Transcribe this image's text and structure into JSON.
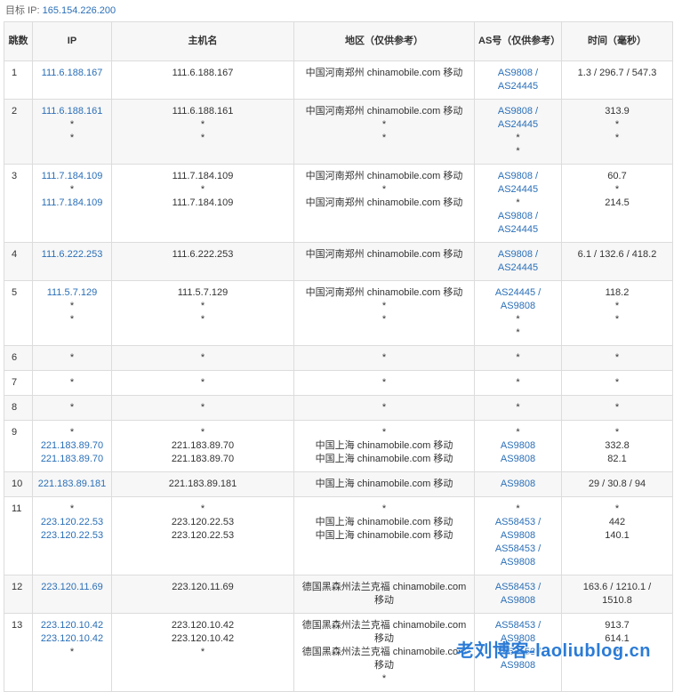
{
  "target": {
    "label": "目标 IP:",
    "ip": "165.154.226.200"
  },
  "headers": [
    "跳数",
    "IP",
    "主机名",
    "地区（仅供参考）",
    "AS号（仅供参考）",
    "时间（毫秒）"
  ],
  "rows": [
    {
      "hop": "1",
      "ip": [
        "111.6.188.167"
      ],
      "host": [
        "111.6.188.167"
      ],
      "region": [
        "中国河南郑州 chinamobile.com 移动"
      ],
      "as": [
        "AS9808 /",
        "AS24445"
      ],
      "time": [
        "1.3 / 296.7 / 547.3"
      ]
    },
    {
      "hop": "2",
      "ip": [
        "111.6.188.161",
        "*",
        "*"
      ],
      "host": [
        "111.6.188.161",
        "*",
        "*"
      ],
      "region": [
        "中国河南郑州 chinamobile.com 移动",
        "*",
        "*"
      ],
      "as": [
        "AS9808 /",
        "AS24445",
        "*",
        "*"
      ],
      "time": [
        "313.9",
        "*",
        "*"
      ]
    },
    {
      "hop": "3",
      "ip": [
        "111.7.184.109",
        "*",
        "111.7.184.109"
      ],
      "host": [
        "111.7.184.109",
        "*",
        "111.7.184.109"
      ],
      "region": [
        "中国河南郑州 chinamobile.com 移动",
        "*",
        "中国河南郑州 chinamobile.com 移动"
      ],
      "as": [
        "AS9808 /",
        "AS24445",
        "*",
        "AS9808 /",
        "AS24445"
      ],
      "time": [
        "60.7",
        "*",
        "214.5"
      ]
    },
    {
      "hop": "4",
      "ip": [
        "111.6.222.253"
      ],
      "host": [
        "111.6.222.253"
      ],
      "region": [
        "中国河南郑州 chinamobile.com 移动"
      ],
      "as": [
        "AS9808 /",
        "AS24445"
      ],
      "time": [
        "6.1 / 132.6 / 418.2"
      ]
    },
    {
      "hop": "5",
      "ip": [
        "111.5.7.129",
        "*",
        "*"
      ],
      "host": [
        "111.5.7.129",
        "*",
        "*"
      ],
      "region": [
        "中国河南郑州 chinamobile.com 移动",
        "*",
        "*"
      ],
      "as": [
        "AS24445 /",
        "AS9808",
        "*",
        "*"
      ],
      "time": [
        "118.2",
        "*",
        "*"
      ]
    },
    {
      "hop": "6",
      "ip": [
        "*"
      ],
      "host": [
        "*"
      ],
      "region": [
        "*"
      ],
      "as": [
        "*"
      ],
      "time": [
        "*"
      ]
    },
    {
      "hop": "7",
      "ip": [
        "*"
      ],
      "host": [
        "*"
      ],
      "region": [
        "*"
      ],
      "as": [
        "*"
      ],
      "time": [
        "*"
      ]
    },
    {
      "hop": "8",
      "ip": [
        "*"
      ],
      "host": [
        "*"
      ],
      "region": [
        "*"
      ],
      "as": [
        "*"
      ],
      "time": [
        "*"
      ]
    },
    {
      "hop": "9",
      "ip": [
        "*",
        "221.183.89.70",
        "221.183.89.70"
      ],
      "host": [
        "*",
        "221.183.89.70",
        "221.183.89.70"
      ],
      "region": [
        "*",
        "中国上海 chinamobile.com 移动",
        "中国上海 chinamobile.com 移动"
      ],
      "as": [
        "*",
        "AS9808",
        "AS9808"
      ],
      "time": [
        "*",
        "332.8",
        "82.1"
      ]
    },
    {
      "hop": "10",
      "ip": [
        "221.183.89.181"
      ],
      "host": [
        "221.183.89.181"
      ],
      "region": [
        "中国上海 chinamobile.com 移动"
      ],
      "as": [
        "AS9808"
      ],
      "time": [
        "29 / 30.8 / 94"
      ]
    },
    {
      "hop": "11",
      "ip": [
        "*",
        "223.120.22.53",
        "223.120.22.53"
      ],
      "host": [
        "*",
        "223.120.22.53",
        "223.120.22.53"
      ],
      "region": [
        "*",
        "中国上海 chinamobile.com 移动",
        "中国上海 chinamobile.com 移动"
      ],
      "as": [
        "*",
        "AS58453 /",
        "AS9808",
        "AS58453 /",
        "AS9808"
      ],
      "time": [
        "*",
        "442",
        "140.1"
      ]
    },
    {
      "hop": "12",
      "ip": [
        "223.120.11.69"
      ],
      "host": [
        "223.120.11.69"
      ],
      "region": [
        "德国黑森州法兰克福 chinamobile.com",
        "移动"
      ],
      "as": [
        "AS58453 /",
        "AS9808"
      ],
      "time": [
        "163.6 / 1210.1 /",
        "1510.8"
      ]
    },
    {
      "hop": "13",
      "ip": [
        "223.120.10.42",
        "223.120.10.42",
        "*"
      ],
      "host": [
        "223.120.10.42",
        "223.120.10.42",
        "*"
      ],
      "region": [
        "德国黑森州法兰克福 chinamobile.com",
        "移动",
        "德国黑森州法兰克福 chinamobile.com",
        "移动",
        "*"
      ],
      "as": [
        "AS58453 /",
        "AS9808",
        "AS58453 /",
        "AS9808"
      ],
      "time": [
        "913.7",
        "614.1",
        "*"
      ]
    }
  ],
  "watermark": "老刘博客-laoliublog.cn",
  "colors": {
    "link": "#2a6fb8",
    "header_bg": "#f7f7f7",
    "border": "#dcdcdc",
    "watermark": "#2b7bd6"
  }
}
